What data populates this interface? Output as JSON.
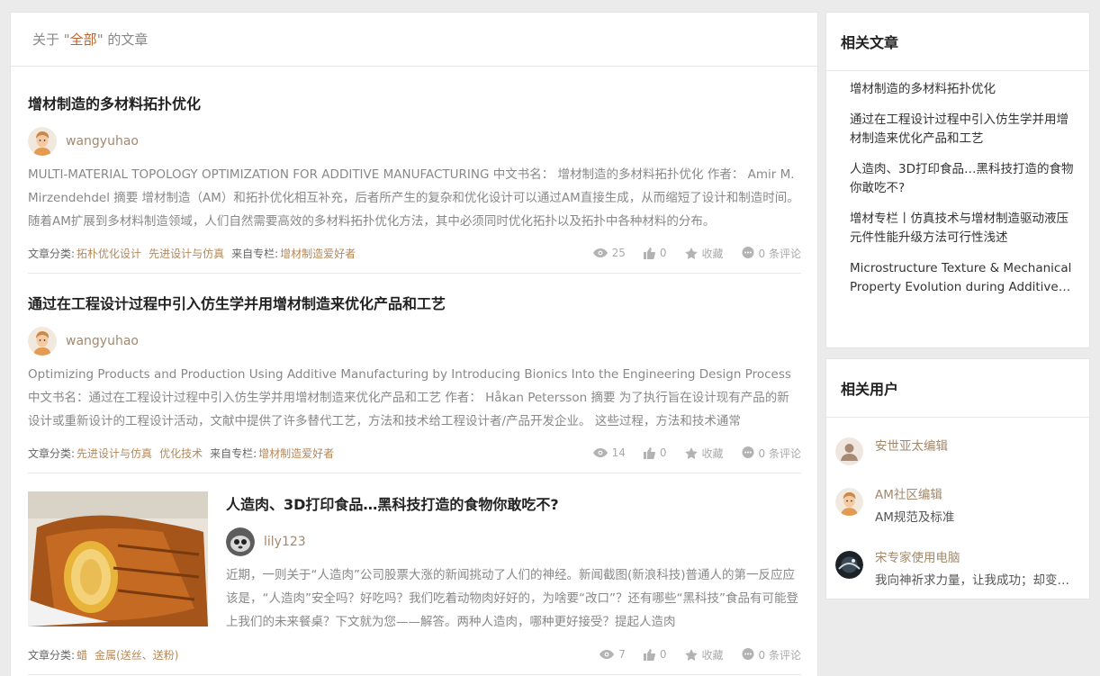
{
  "header": {
    "prefix": "关于 \"",
    "keyword": "全部",
    "suffix": "\" 的文章"
  },
  "articles": [
    {
      "title": "增材制造的多材料拓扑优化",
      "author": "wangyuhao",
      "summary": "MULTI-MATERIAL TOPOLOGY OPTIMIZATION FOR ADDITIVE MANUFACTURING 中文书名： 增材制造的多材料拓扑优化 作者： Amir M. Mirzendehdel 摘要 增材制造（AM）和拓扑优化相互补充，后者所产生的复杂和优化设计可以通过AM直接生成，从而缩短了设计和制造时间。随着AM扩展到多材料制造领域，人们自然需要高效的多材料拓扑优化方法，其中必须同时优化拓扑以及拓扑中各种材料的分布。",
      "category_label": "文章分类:",
      "categories": [
        "拓朴优化设计",
        "先进设计与仿真"
      ],
      "column_label": "来自专栏:",
      "column": "增材制造爱好者",
      "views": "25",
      "likes": "0",
      "favorite": "收藏",
      "comments": "0 条评论"
    },
    {
      "title": "通过在工程设计过程中引入仿生学并用增材制造来优化产品和工艺",
      "author": "wangyuhao",
      "summary": "Optimizing Products and Production Using Additive Manufacturing by Introducing Bionics Into the Engineering Design Process 中文书名：通过在工程设计过程中引入仿生学并用增材制造来优化产品和工艺 作者： Håkan Petersson 摘要 为了执行旨在设计现有产品的新设计或重新设计的工程设计活动，文献中提供了许多替代工艺，方法和技术给工程设计者/产品开发企业。 这些过程，方法和技术通常",
      "category_label": "文章分类:",
      "categories": [
        "先进设计与仿真",
        "优化技术"
      ],
      "column_label": "来自专栏:",
      "column": "增材制造爱好者",
      "views": "14",
      "likes": "0",
      "favorite": "收藏",
      "comments": "0 条评论"
    },
    {
      "title": "人造肉、3D打印食品…黑科技打造的食物你敢吃不?",
      "author": "lily123",
      "summary": "近期，一则关于“人造肉”公司股票大涨的新闻挑动了人们的神经。新闻截图(新浪科技)普通人的第一反应应该是，“人造肉”安全吗？好吃吗？我们吃着动物肉好好的，为啥要“改口”？还有哪些“黑科技”食品有可能登上我们的未来餐桌？下文就为您——解答。两种人造肉，哪种更好接受？提起人造肉",
      "category_label": "文章分类:",
      "categories": [
        "蜡",
        "金属(送丝、送粉)"
      ],
      "views": "7",
      "likes": "0",
      "favorite": "收藏",
      "comments": "0 条评论"
    }
  ],
  "related_articles": {
    "title": "相关文章",
    "items": [
      "增材制造的多材料拓扑优化",
      "通过在工程设计过程中引入仿生学并用增材制造来优化产品和工艺",
      "人造肉、3D打印食品…黑科技打造的食物你敢吃不?",
      "增材专栏丨仿真技术与增材制造驱动液压元件性能升级方法可行性浅述",
      "Microstructure Texture & Mechanical Property Evolution during Additive Manufacturing"
    ]
  },
  "related_users": {
    "title": "相关用户",
    "items": [
      {
        "name": "安世亚太编辑",
        "desc": ""
      },
      {
        "name": "AM社区编辑",
        "desc": "AM规范及标准"
      },
      {
        "name": "宋专家使用电脑",
        "desc": "我向神祈求力量，让我成功；却变得弱小"
      }
    ]
  },
  "colors": {
    "accent": "#c0612b",
    "link": "#a2896e",
    "tag": "#b5885a"
  }
}
